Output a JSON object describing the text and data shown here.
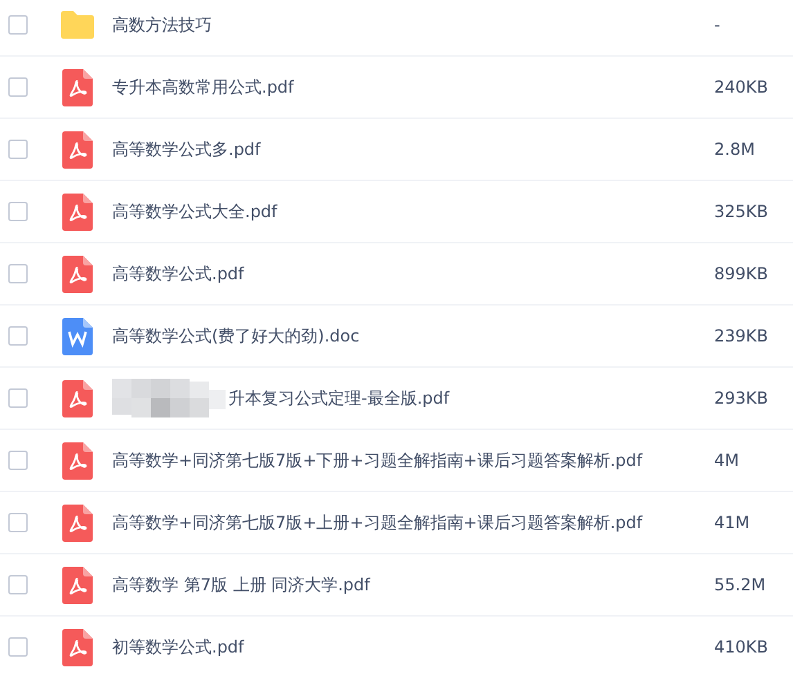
{
  "files": [
    {
      "kind": "folder",
      "name": "高数方法技巧",
      "size": "-",
      "checked": false
    },
    {
      "kind": "pdf",
      "name": "专升本高数常用公式.pdf",
      "size": "240KB",
      "checked": false
    },
    {
      "kind": "pdf",
      "name": "高等数学公式多.pdf",
      "size": "2.8M",
      "checked": false
    },
    {
      "kind": "pdf",
      "name": "高等数学公式大全.pdf",
      "size": "325KB",
      "checked": false
    },
    {
      "kind": "pdf",
      "name": "高等数学公式.pdf",
      "size": "899KB",
      "checked": false
    },
    {
      "kind": "doc",
      "name": "高等数学公式(费了好大的劲).doc",
      "size": "239KB",
      "checked": false
    },
    {
      "kind": "pdf",
      "name": "升本复习公式定理-最全版.pdf",
      "size": "293KB",
      "checked": false,
      "redacted": true
    },
    {
      "kind": "pdf",
      "name": "高等数学+同济第七版7版+下册+习题全解指南+课后习题答案解析.pdf",
      "size": "4M",
      "checked": false
    },
    {
      "kind": "pdf",
      "name": "高等数学+同济第七版7版+上册+习题全解指南+课后习题答案解析.pdf",
      "size": "41M",
      "checked": false
    },
    {
      "kind": "pdf",
      "name": "高等数学 第7版 上册 同济大学.pdf",
      "size": "55.2M",
      "checked": false
    },
    {
      "kind": "pdf",
      "name": "初等数学公式.pdf",
      "size": "410KB",
      "checked": false
    }
  ]
}
